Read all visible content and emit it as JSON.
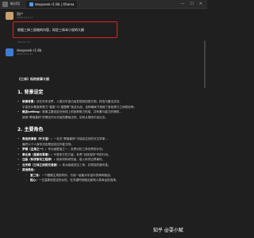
{
  "window": {
    "title": "新对话",
    "tab": "deepseek-r1:8b | Ollama",
    "controls": [
      "—",
      "☐",
      "✕"
    ]
  },
  "user_message": {
    "name": "用户",
    "time": "2025-2-11 17",
    "text": "根据三体三部曲的内容，拟定三体本小说的大纲",
    "meta": "Tokens: 31"
  },
  "bot_message": {
    "name": "deepseek-r1:8b",
    "time": "2025-2-11 17"
  },
  "document": {
    "title": "《三体》拟的故事大纲",
    "section1": "1. 背景设定",
    "bullets1": [
      {
        "label": "故事背景：",
        "text": "设在未来世界，人类对宇宙已经发现到四型文明，科技与魔法并存。"
      },
      {
        "label": "",
        "text": "宇宙充斥着各种势力“星族”与“星盟联”各自为战，这种格局下造就了各色势力之间的纷争。"
      },
      {
        "label": "概念setting：",
        "text": "故事主要设定在地球上的各种势力构成，并有着与能力的博弈…"
      },
      {
        "label": "",
        "text": "使用“黑暗森林”的理论作为宇宙的基础法则，如何从规则中走出去。"
      }
    ],
    "section2": "2. 主要角色",
    "bullets2": [
      {
        "label": "角色扮演者（叶文洁）：",
        "text": "一名在“黑暗森林”中独自生存的天文学家…"
      },
      {
        "label": "",
        "text": "最终以个人身份决定是否回应外星文明。"
      },
      {
        "label": "罗辑（主角之一）：",
        "text": "作为面壁者之一，负责对抗三体世界的计划。"
      },
      {
        "label": "章北海（星舰与军事）：",
        "text": "代表军方的力量，负责“自然选择”号的行动。"
      },
      {
        "label": "汪淼（科学家与工程师）：",
        "text": "纳米材料研究者，卷入科学边界事件。"
      },
      {
        "label": "云天明（三体之间的交流者）：",
        "text": "其大脑被送往三体，并带回关键讯息。"
      },
      {
        "label": "其他角色：",
        "text": ""
      }
    ],
    "sub_bullets": [
      {
        "label": "第二世：",
        "text": "一个跟随主角的同伴，与他一起面对宇宙中的种种挑战。"
      },
      {
        "label": "程心：",
        "text": "一位温柔而坚定的女性，在关键时刻做出影响人类命运的选择。"
      }
    ]
  },
  "watermark": "知乎 @耍小赋"
}
